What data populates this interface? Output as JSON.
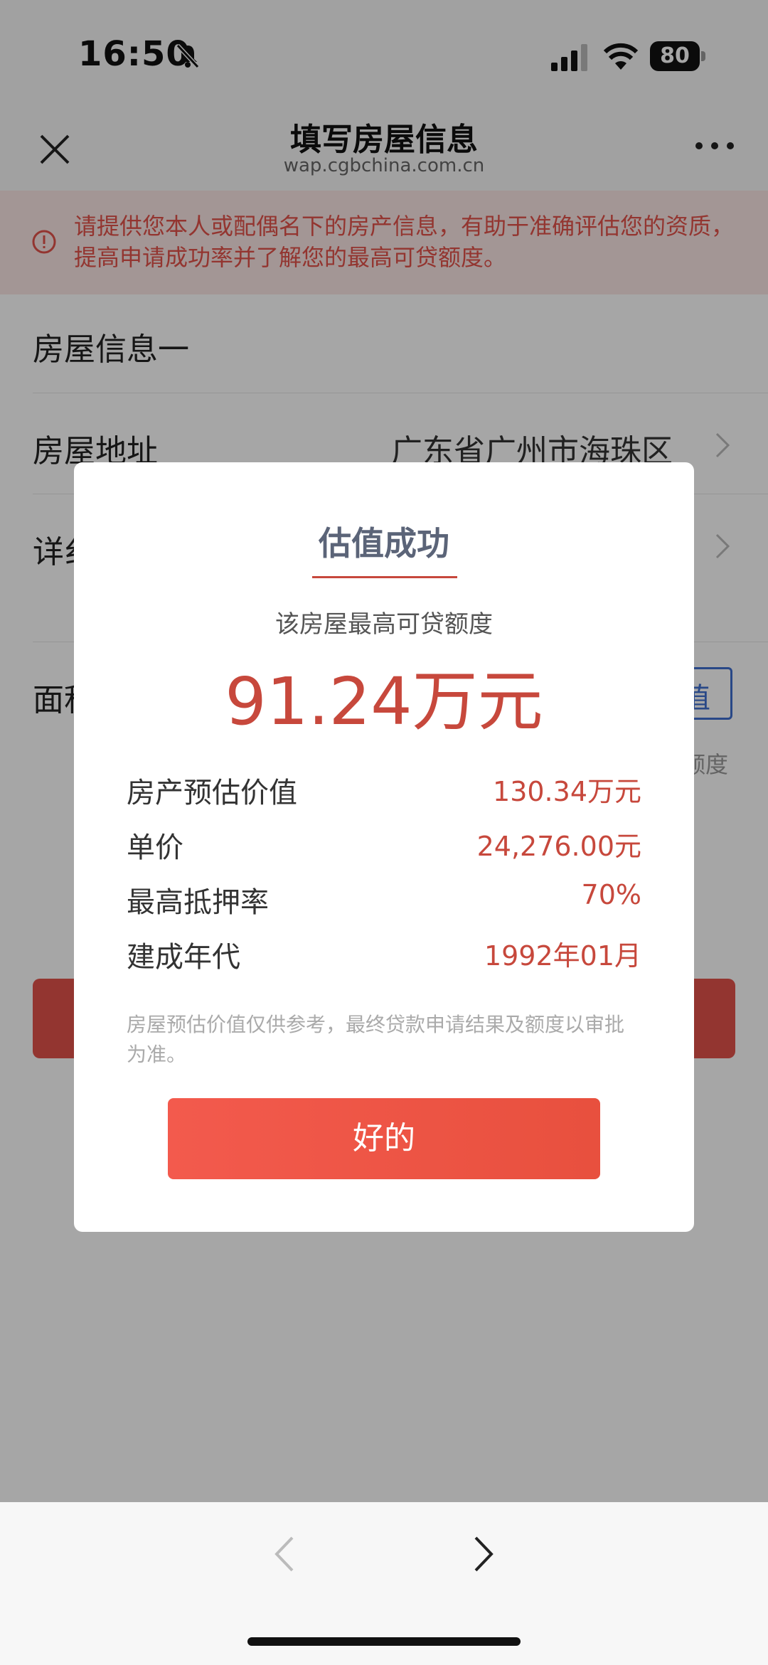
{
  "status_bar": {
    "time": "16:50",
    "battery": "80",
    "icons": [
      "mute-icon",
      "signal-icon",
      "wifi-icon",
      "battery-icon"
    ]
  },
  "header": {
    "title": "填写房屋信息",
    "url": "wap.cgbchina.com.cn",
    "icons": [
      "close-icon",
      "more-icon"
    ]
  },
  "notice": {
    "text": "请提供您本人或配偶名下的房产信息，有助于准确评估您的资质，提高申请成功率并了解您的最高可贷额度。",
    "icon": "warning-circle-icon",
    "color": "#e2524a"
  },
  "form": {
    "section_title": "房屋信息一",
    "address_label": "房屋地址",
    "address_value": "广东省广州市海珠区",
    "detail_label_partial": "详纟",
    "area_label_partial": "面积",
    "valuate_button_partial": "值",
    "limit_text_partial": "额度"
  },
  "dialog": {
    "title": "估值成功",
    "subtitle": "该房屋最高可贷额度",
    "amount": "91.24万元",
    "rows": [
      {
        "label": "房产预估价值",
        "value": "130.34万元"
      },
      {
        "label": "单价",
        "value": "24,276.00元"
      },
      {
        "label": "最高抵押率",
        "value": "70%"
      },
      {
        "label": "建成年代",
        "value": "1992年01月"
      }
    ],
    "note": "房屋预估价值仅供参考，最终贷款申请结果及额度以审批为准。",
    "ok_button": "好的",
    "accent_color": "#c7483c"
  },
  "toolbar": {
    "icons": [
      "back-arrow-icon",
      "forward-arrow-icon"
    ]
  }
}
